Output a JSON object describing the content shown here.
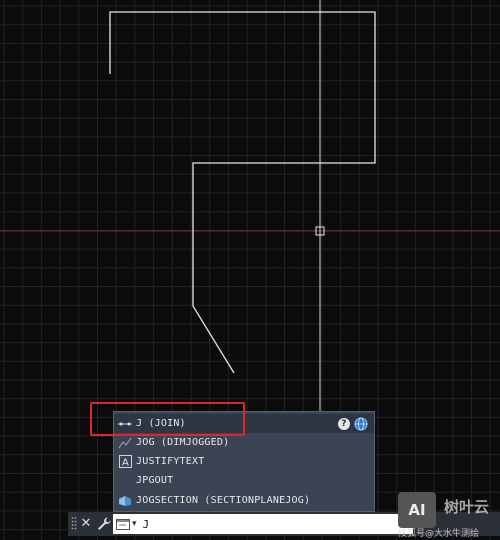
{
  "autocomplete": {
    "items": [
      {
        "icon": "join-icon",
        "label": "J (JOIN)"
      },
      {
        "icon": "jog-icon",
        "label": "JOG (DIMJOGGED)"
      },
      {
        "icon": "text-icon",
        "label": "JUSTIFYTEXT"
      },
      {
        "icon": "",
        "label": "JPGOUT"
      },
      {
        "icon": "section-icon",
        "label": "JOGSECTION (SECTIONPLANEJOG)"
      }
    ],
    "help_label": "?"
  },
  "command_line": {
    "close_label": "✕",
    "caret": "▾",
    "input_value": "J"
  },
  "watermark": {
    "logo": "AI",
    "brand": "树叶云",
    "sub": "搜狐号@大水牛测绘"
  },
  "colors": {
    "background": "#0b0b0b",
    "grid": "#1f232a",
    "crosshair_horizontal": "#8a2a22",
    "highlight": "#e0262a",
    "panel": "#3b4453"
  }
}
